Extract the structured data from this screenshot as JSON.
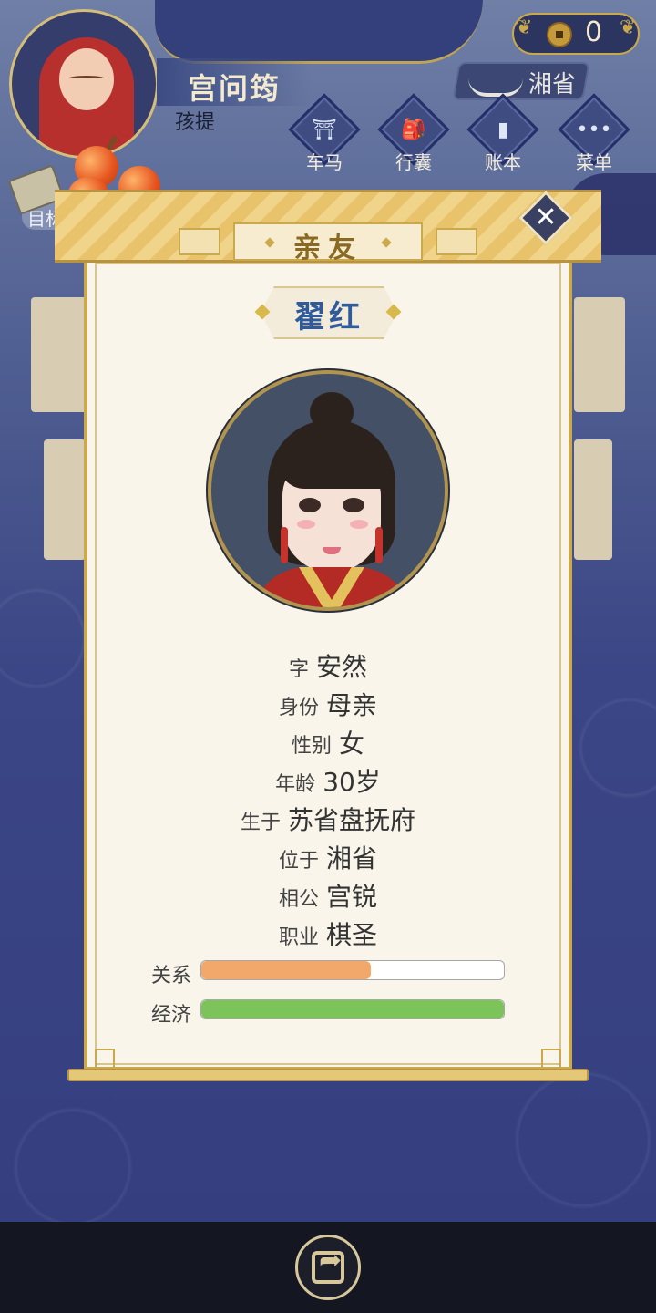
{
  "header": {
    "player_name": "宫问筠",
    "player_sub": "孩提",
    "coins": "0",
    "location": "湘省"
  },
  "menu": [
    {
      "label": "车马",
      "icon": "carriage-icon",
      "glyph": "⛩"
    },
    {
      "label": "行囊",
      "icon": "bag-icon",
      "glyph": "🎒"
    },
    {
      "label": "账本",
      "icon": "ledger-icon",
      "glyph": "▮"
    },
    {
      "label": "菜单",
      "icon": "more-icon",
      "glyph": "•••"
    }
  ],
  "target": {
    "label": "目标"
  },
  "dialog": {
    "title": "亲友",
    "close_glyph": "✕",
    "name": "翟红",
    "info": [
      {
        "key": "字",
        "value": "安然"
      },
      {
        "key": "身份",
        "value": "母亲"
      },
      {
        "key": "性别",
        "value": "女"
      },
      {
        "key": "年龄",
        "value": "30岁"
      },
      {
        "key": "生于",
        "value": "苏省盘抚府"
      },
      {
        "key": "位于",
        "value": "湘省"
      },
      {
        "key": "相公",
        "value": "宫锐"
      },
      {
        "key": "职业",
        "value": "棋圣"
      }
    ],
    "bars": [
      {
        "label": "关系",
        "fraction": 0.56,
        "color": "#f1a86a"
      },
      {
        "label": "经济",
        "fraction": 1.0,
        "color": "#7cc35a"
      }
    ]
  },
  "colors": {
    "accent_gold": "#c9a94b",
    "name_blue": "#2f5a9c",
    "background_navy": "#353f80"
  },
  "bottom": {
    "share_icon": "share-icon",
    "share_glyph": "➦"
  }
}
